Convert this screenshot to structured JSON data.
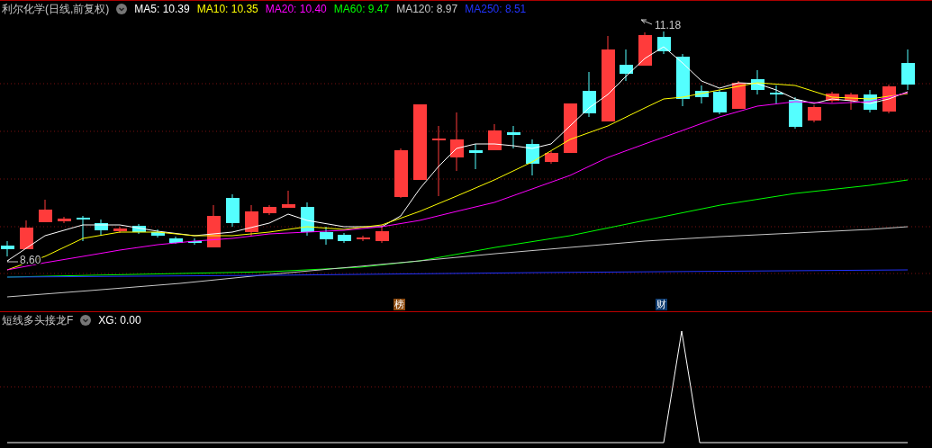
{
  "main_panel": {
    "title": "利尔化学(日线,前复权)",
    "indicators": [
      {
        "label": "MA5: 10.39",
        "color": "#ffffff"
      },
      {
        "label": "MA10: 10.35",
        "color": "#ffff00"
      },
      {
        "label": "MA20: 10.40",
        "color": "#ff00ff"
      },
      {
        "label": "MA60: 9.47",
        "color": "#00ff00"
      },
      {
        "label": "MA120: 8.97",
        "color": "#c8c8c8"
      },
      {
        "label": "MA250: 8.51",
        "color": "#2233ff"
      }
    ],
    "high_label": "11.18",
    "low_label": "8.60",
    "markers": [
      {
        "label": "榜",
        "color": "#8b4a10"
      },
      {
        "label": "财",
        "color": "#0d3a6e"
      }
    ]
  },
  "sub_panel": {
    "title": "短线多头接龙F",
    "indicators": [
      {
        "label": "XG: 0.00",
        "color": "#ffffff"
      }
    ]
  }
}
